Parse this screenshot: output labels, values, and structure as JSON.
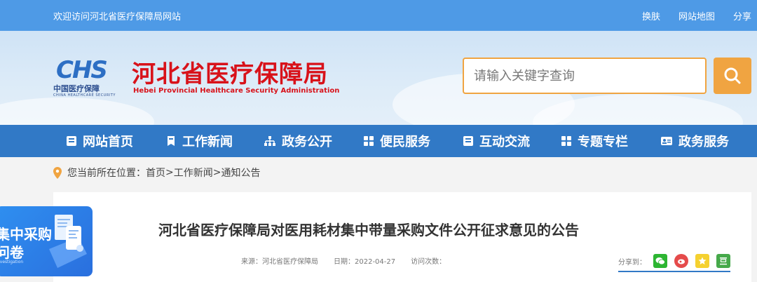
{
  "topbar": {
    "welcome": "欢迎访问河北省医疗保障局网站",
    "links": [
      "换肤",
      "网站地图",
      "分享"
    ]
  },
  "header": {
    "logo_text": "CHS",
    "logo_cn": "中国医疗保障",
    "logo_en": "CHINA HEALTHCARE SECURITY",
    "title": "河北省医疗保障局",
    "subtitle": "Hebei Provincial Healthcare Security Administration",
    "search_placeholder": "请输入关键字查询"
  },
  "nav": {
    "items": [
      {
        "label": "网站首页",
        "icon": "doc-list-icon"
      },
      {
        "label": "工作新闻",
        "icon": "bookmark-icon"
      },
      {
        "label": "政务公开",
        "icon": "org-chart-icon"
      },
      {
        "label": "便民服务",
        "icon": "grid-icon"
      },
      {
        "label": "互动交流",
        "icon": "doc-list-icon"
      },
      {
        "label": "专题专栏",
        "icon": "grid-icon"
      },
      {
        "label": "政务服务",
        "icon": "id-card-icon"
      }
    ]
  },
  "breadcrumb": {
    "prefix": "您当前所在位置：",
    "home": "首页",
    "sep1": ">",
    "section": "工作新闻",
    "sep2": ">",
    "current": "通知公告"
  },
  "article": {
    "title": "河北省医疗保障局对医用耗材集中带量采购文件公开征求意见的公告",
    "source_label": "来源：",
    "source": "河北省医疗保障局",
    "date_label": "日期：",
    "date": "2022-04-27",
    "views_label": "访问次数：",
    "share_label": "分享到："
  },
  "float_banner": {
    "line1": "集中采购",
    "line2": "问卷",
    "line3": "nvestigation"
  },
  "colors": {
    "topbar": "#4e9ae6",
    "nav": "#3179c6",
    "accent": "#f0a441",
    "title_red": "#d8121a"
  }
}
